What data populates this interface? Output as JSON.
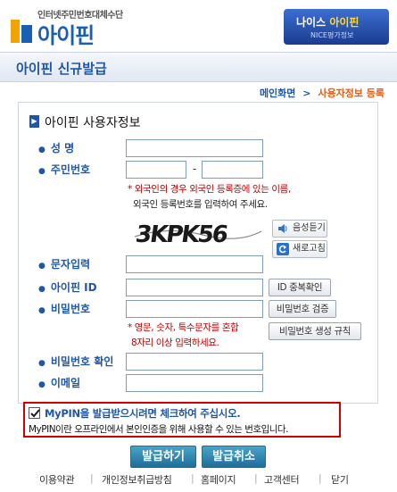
{
  "header": {
    "logo_sub": "인터넷주민번호대체수단",
    "logo_main": "아이핀",
    "badge_title_prefix": "나이스",
    "badge_title_highlight": "아이핀",
    "badge_sub": "NICE평가정보"
  },
  "title_bar": {
    "title": "아이핀 신규발급"
  },
  "breadcrumb": {
    "home": "메인화면",
    "separator": ">",
    "current": "사용자정보 등록"
  },
  "panel": {
    "heading": "아이핀 사용자정보",
    "name_label": "성  명",
    "rrn_label": "주민번호",
    "rrn_dash": "-",
    "rrn_note_line1": "* 외국인의 경우 외국인 등록증에 있는 이름,",
    "rrn_note_line2": "외국인 등록번호를 입력하여 주세요.",
    "captcha_text": "3KPK56",
    "audio_button": "음성듣기",
    "refresh_button": "새로고침",
    "captcha_label": "문자입력",
    "id_label": "아이핀 ID",
    "id_check_button": "ID 중복확인",
    "pw_label": "비밀번호",
    "pw_check_button": "비밀번호 검증",
    "pw_rule_button": "비밀번호 생성 규칙",
    "pw_note_line1": "* 영문, 숫자, 특수문자를 혼합",
    "pw_note_line2": "8자리 이상 입력하세요.",
    "pw_confirm_label": "비밀번호 확인",
    "email_label": "이메일"
  },
  "notice": {
    "checked": true,
    "main": "MyPIN을 발급받으시려면 체크하여 주십시오.",
    "sub": "MyPIN이란 오프라인에서 본인인증을 위해 사용할 수 있는 번호입니다."
  },
  "actions": {
    "issue": "발급하기",
    "cancel": "발급취소"
  },
  "footer": {
    "links": [
      "이용약관",
      "개인정보취급방침",
      "홈페이지",
      "고객센터",
      "닫기"
    ],
    "separator": "|"
  },
  "colors": {
    "brand_blue": "#1e56a8",
    "accent_orange": "#e0601a",
    "warning_red": "#c00000"
  }
}
